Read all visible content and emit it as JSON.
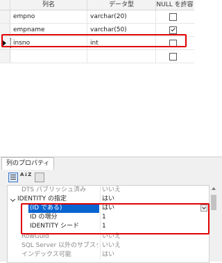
{
  "grid": {
    "headers": [
      "列名",
      "データ型",
      "NULL を許容"
    ],
    "rows": [
      {
        "name": "empno",
        "type": "varchar(20)",
        "nullable": false
      },
      {
        "name": "empname",
        "type": "varchar(50)",
        "nullable": true
      },
      {
        "name": "insno",
        "type": "int",
        "nullable": false
      },
      {
        "name": "",
        "type": "",
        "nullable": false
      }
    ]
  },
  "panel": {
    "tab_label": "列のプロパティ",
    "sort_icon_text": "A↓Z",
    "properties": [
      {
        "name": "DTS パブリッシュ済み",
        "value": "いいえ",
        "muted": true
      },
      {
        "name": "IDENTITY の指定",
        "value": "はい",
        "muted": false
      },
      {
        "name": "(ID である)",
        "value": "はい",
        "muted": false
      },
      {
        "name": "ID の増分",
        "value": "1",
        "muted": false
      },
      {
        "name": "IDENTITY シード",
        "value": "1",
        "muted": false
      },
      {
        "name": "RowGuid",
        "value": "いいえ",
        "muted": true
      },
      {
        "name": "SQL Server 以外のサブスクライバー",
        "value": "いいえ",
        "muted": true
      },
      {
        "name": "インデックス可能",
        "value": "はい",
        "muted": true
      }
    ]
  },
  "colors": {
    "highlight_box": "#e00000",
    "selection": "#0a64d0"
  }
}
